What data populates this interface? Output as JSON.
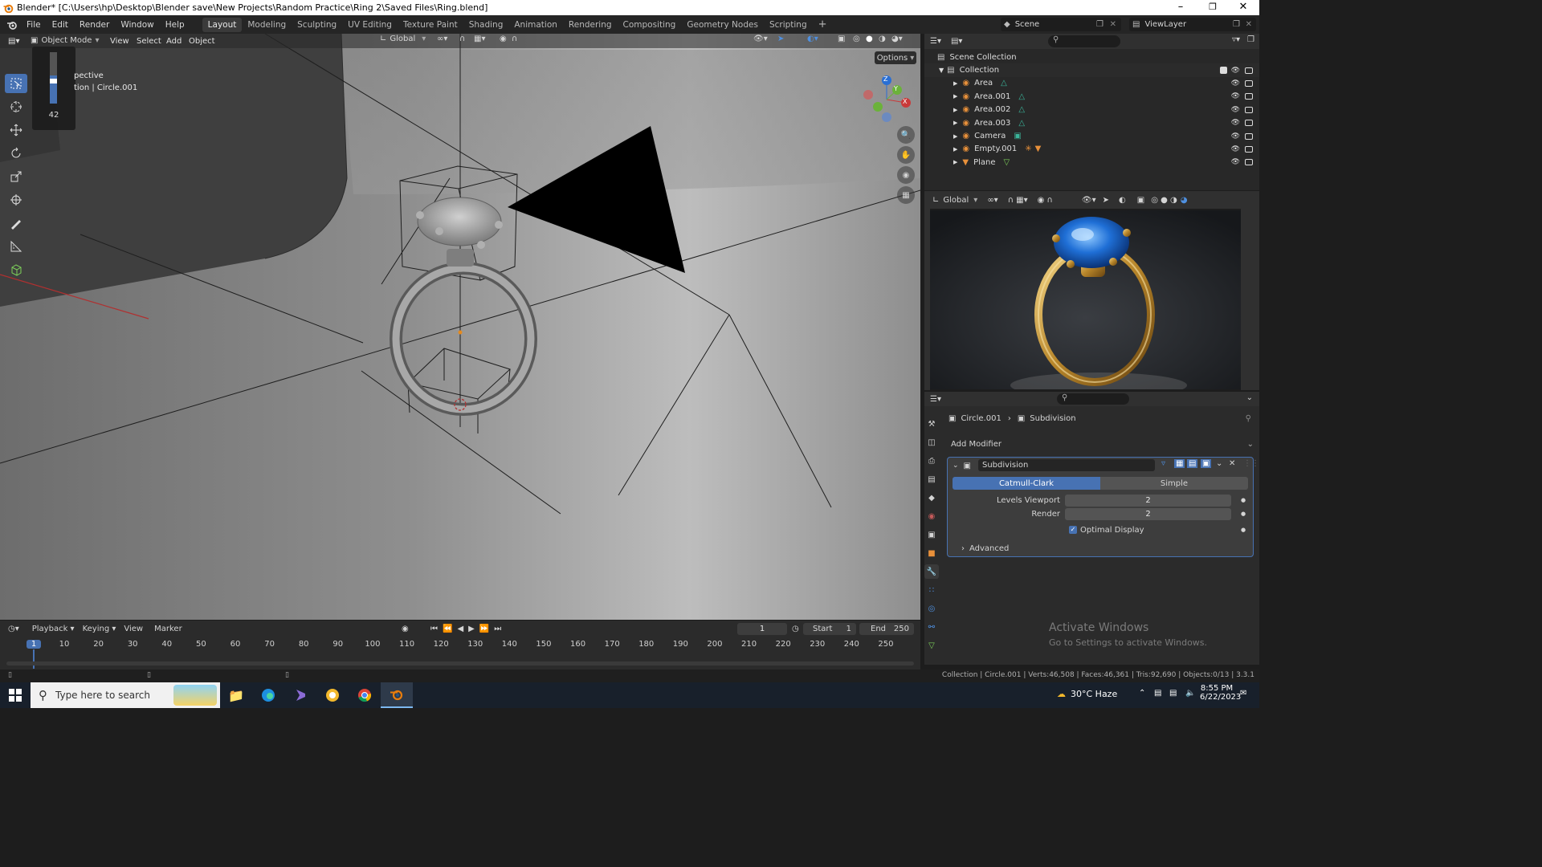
{
  "window": {
    "title": "Blender* [C:\\Users\\hp\\Desktop\\Blender save\\New Projects\\Random Practice\\Ring 2\\Saved Files\\Ring.blend]"
  },
  "menu": [
    "File",
    "Edit",
    "Render",
    "Window",
    "Help"
  ],
  "workspaces": [
    "Layout",
    "Modeling",
    "Sculpting",
    "UV Editing",
    "Texture Paint",
    "Shading",
    "Animation",
    "Rendering",
    "Compositing",
    "Geometry Nodes",
    "Scripting"
  ],
  "active_workspace": "Layout",
  "scene_name": "Scene",
  "view_layer": "ViewLayer",
  "viewport": {
    "mode": "Object Mode",
    "menus": [
      "View",
      "Select",
      "Add",
      "Object"
    ],
    "orientation": "Global",
    "options_label": "Options",
    "overlay_text_1": "pective",
    "overlay_text_2": "tion | Circle.001",
    "slider_value": "42",
    "gizmo_axes": [
      "Z",
      "Y",
      "X"
    ]
  },
  "outliner": {
    "root": "Scene Collection",
    "collection": "Collection",
    "items": [
      {
        "name": "Area",
        "color": "#e8903a"
      },
      {
        "name": "Area.001",
        "color": "#e8903a"
      },
      {
        "name": "Area.002",
        "color": "#e8903a"
      },
      {
        "name": "Area.003",
        "color": "#e8903a"
      },
      {
        "name": "Camera",
        "color": "#e8903a"
      },
      {
        "name": "Empty.001",
        "color": "#e8903a"
      },
      {
        "name": "Plane",
        "color": "#e8903a"
      }
    ]
  },
  "render_view": {
    "orientation": "Global"
  },
  "properties": {
    "object": "Circle.001",
    "modifier_crumb": "Subdivision",
    "add_modifier": "Add Modifier",
    "modifier_name": "Subdivision",
    "mode_a": "Catmull-Clark",
    "mode_b": "Simple",
    "levels_label": "Levels Viewport",
    "levels_value": "2",
    "render_label": "Render",
    "render_value": "2",
    "optimal_label": "Optimal Display",
    "advanced_label": "Advanced"
  },
  "watermark": {
    "line1": "Activate Windows",
    "line2": "Go to Settings to activate Windows."
  },
  "timeline": {
    "menus": [
      "Playback",
      "Keying",
      "View",
      "Marker"
    ],
    "current_frame": "1",
    "start_label": "Start",
    "start_value": "1",
    "end_label": "End",
    "end_value": "250",
    "ticks": [
      "1",
      "10",
      "20",
      "30",
      "40",
      "50",
      "60",
      "70",
      "80",
      "90",
      "100",
      "110",
      "120",
      "130",
      "140",
      "150",
      "160",
      "170",
      "180",
      "190",
      "200",
      "210",
      "220",
      "230",
      "240",
      "250"
    ]
  },
  "status_bar": {
    "text": "Collection | Circle.001 | Verts:46,508 | Faces:46,361 | Tris:92,690 | Objects:0/13 | 3.3.1"
  },
  "taskbar": {
    "search_placeholder": "Type here to search",
    "weather": "30°C  Haze",
    "time": "8:55 PM",
    "date": "6/22/2023"
  },
  "colors": {
    "accent": "#4772b3",
    "selected": "#4772b3"
  }
}
